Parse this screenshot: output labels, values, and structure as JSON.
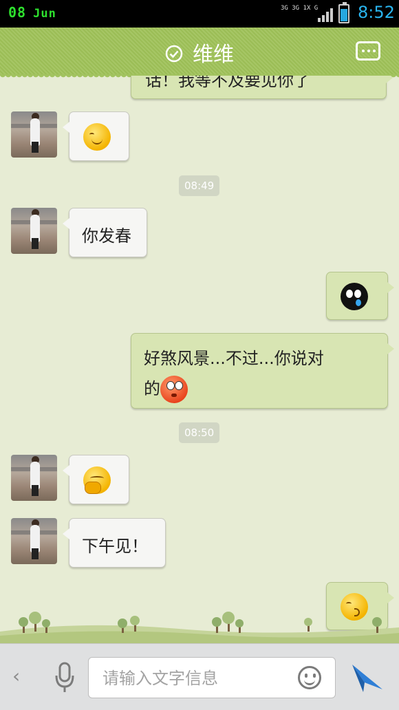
{
  "status_bar": {
    "date_day": "08",
    "date_month": "Jun",
    "network_labels": [
      "3G",
      "3G",
      "1X",
      "G"
    ],
    "time": "8:52",
    "battery_color": "#27a8e0"
  },
  "header": {
    "title": "维维",
    "verified_icon": "check-circle-icon",
    "more_icon": "more-dots-icon",
    "bg_color": "#a2c35f"
  },
  "messages": [
    {
      "side": "right",
      "type": "text",
      "text": "话！我等不及要见你了"
    },
    {
      "side": "left",
      "type": "emoji",
      "emoji": "smile-emoji"
    },
    {
      "type": "time",
      "text": "08:49"
    },
    {
      "side": "left",
      "type": "text",
      "text": "你发春"
    },
    {
      "side": "right",
      "type": "emoji",
      "emoji": "black-crying-emoji"
    },
    {
      "side": "right",
      "type": "text",
      "text": "好煞风景...不过...你说对",
      "text2": "的",
      "emoji": "red-face-emoji"
    },
    {
      "type": "time",
      "text": "08:50"
    },
    {
      "side": "left",
      "type": "emoji",
      "emoji": "covering-mouth-emoji"
    },
    {
      "side": "left",
      "type": "text",
      "text": "下午见！"
    },
    {
      "side": "right",
      "type": "emoji",
      "emoji": "kiss-emoji"
    }
  ],
  "input_bar": {
    "back_label": "‹",
    "mic_icon": "microphone-icon",
    "placeholder": "请输入文字信息",
    "emoji_icon": "smiley-icon",
    "send_icon": "send-icon",
    "send_color": "#2f7fd6"
  }
}
